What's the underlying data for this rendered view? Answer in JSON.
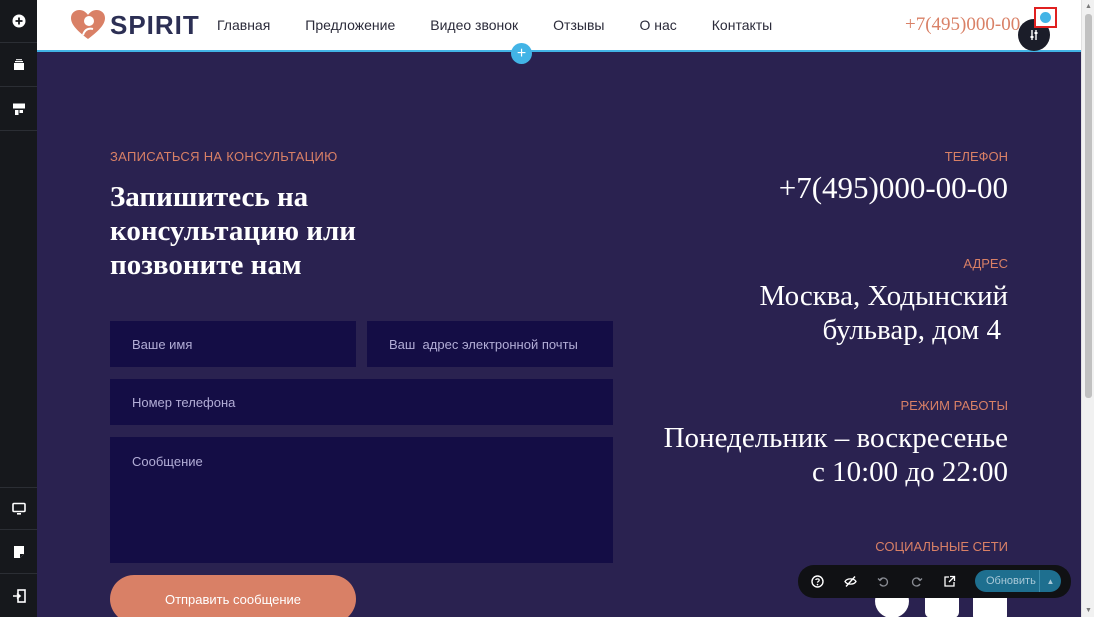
{
  "site": {
    "logo_text": "SPIRIT",
    "nav": [
      "Главная",
      "Предложение",
      "Видео звонок",
      "Отзывы",
      "О нас",
      "Контакты"
    ],
    "header_phone": "+7(495)000-00"
  },
  "editor": {
    "add_section": "+",
    "update_label": "Обновить"
  },
  "contact": {
    "eyebrow": "ЗАПИСАТЬСЯ НА КОНСУЛЬТАЦИЮ",
    "heading": "Запишитесь на консультацию или позвоните нам",
    "form": {
      "name_placeholder": "Ваше имя",
      "email_placeholder": "Ваш  адрес электронной почты",
      "phone_placeholder": "Номер телефона",
      "message_placeholder": "Сообщение",
      "submit_label": "Отправить сообщение"
    },
    "phone_label": "ТЕЛЕФОН",
    "phone_value": "+7(495)000-00-00",
    "address_label": "АДРЕС",
    "address_line1": "Москва, Ходынский",
    "address_line2": "бульвар, дом 4",
    "hours_label": "РЕЖИМ РАБОТЫ",
    "hours_line1": "Понедельник – воскресенье",
    "hours_line2": "с 10:00 до 22:00",
    "social_label": "СОЦИАЛЬНЫЕ СЕТИ"
  },
  "colors": {
    "accent": "#d98066",
    "section_bg": "#2a2250",
    "field_bg": "#140d45",
    "editor_blue": "#42b4e6"
  },
  "icons": {
    "leftbar": [
      "add-icon",
      "layers-icon",
      "blocks-icon",
      "desktop-icon",
      "pages-icon",
      "exit-icon"
    ],
    "toolbar": [
      "help-icon",
      "hide-icon",
      "undo-icon",
      "redo-icon",
      "external-link-icon"
    ]
  }
}
